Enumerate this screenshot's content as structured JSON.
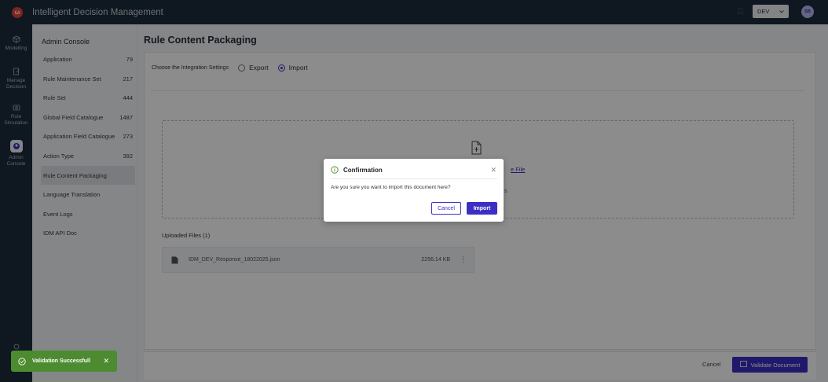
{
  "app": {
    "logo_letter": "ω",
    "title": "Intelligent Decision Management"
  },
  "header": {
    "env_value": "DEV",
    "avatar_initials": "SB"
  },
  "rail": {
    "items": [
      {
        "label_line1": "Modelling",
        "label_line2": "",
        "icon": "cube-icon"
      },
      {
        "label_line1": "Manage",
        "label_line2": "Decision",
        "icon": "edit-doc-icon"
      },
      {
        "label_line1": "Rule",
        "label_line2": "Simulation",
        "icon": "simulation-icon"
      },
      {
        "label_line1": "Admin",
        "label_line2": "Console",
        "icon": "admin-icon"
      }
    ]
  },
  "subsidebar": {
    "title": "Admin Console",
    "items": [
      {
        "label": "Application",
        "count": "79"
      },
      {
        "label": "Rule Maintenance Set",
        "count": "217"
      },
      {
        "label": "Rule Set",
        "count": "444"
      },
      {
        "label": "Global Field Catalogue",
        "count": "1487"
      },
      {
        "label": "Application Field Catalogue",
        "count": "273"
      },
      {
        "label": "Action Type",
        "count": "392"
      },
      {
        "label": "Rule Content Packaging",
        "count": ""
      },
      {
        "label": "Language Translation",
        "count": ""
      },
      {
        "label": "Event Logs",
        "count": ""
      },
      {
        "label": "IDM API Doc",
        "count": ""
      }
    ]
  },
  "main": {
    "title": "Rule Content Packaging",
    "integration_label": "Choose the Integration Settings",
    "export_label": "Export",
    "import_label": "Import",
    "selected": "Import",
    "choose_file_link": "e File",
    "drop_sub": "s",
    "uploaded_title": "Uploaded Files (1)",
    "file": {
      "name": "IDM_DEV_Response_18022025.json",
      "size": "2256.14 KB"
    }
  },
  "footer": {
    "cancel_label": "Cancel",
    "validate_label": "Validate Document"
  },
  "toast": {
    "message": "Validation Successfull",
    "close": "✕"
  },
  "modal": {
    "title": "Confirmation",
    "close": "✕",
    "message": "Are you sure you want to import this document here?",
    "cancel_label": "Cancel",
    "import_label": "Import"
  },
  "colors": {
    "primary": "#3b2fc4",
    "sidebar_bg": "#1d2a3b",
    "toast_bg": "#4d8b31"
  }
}
